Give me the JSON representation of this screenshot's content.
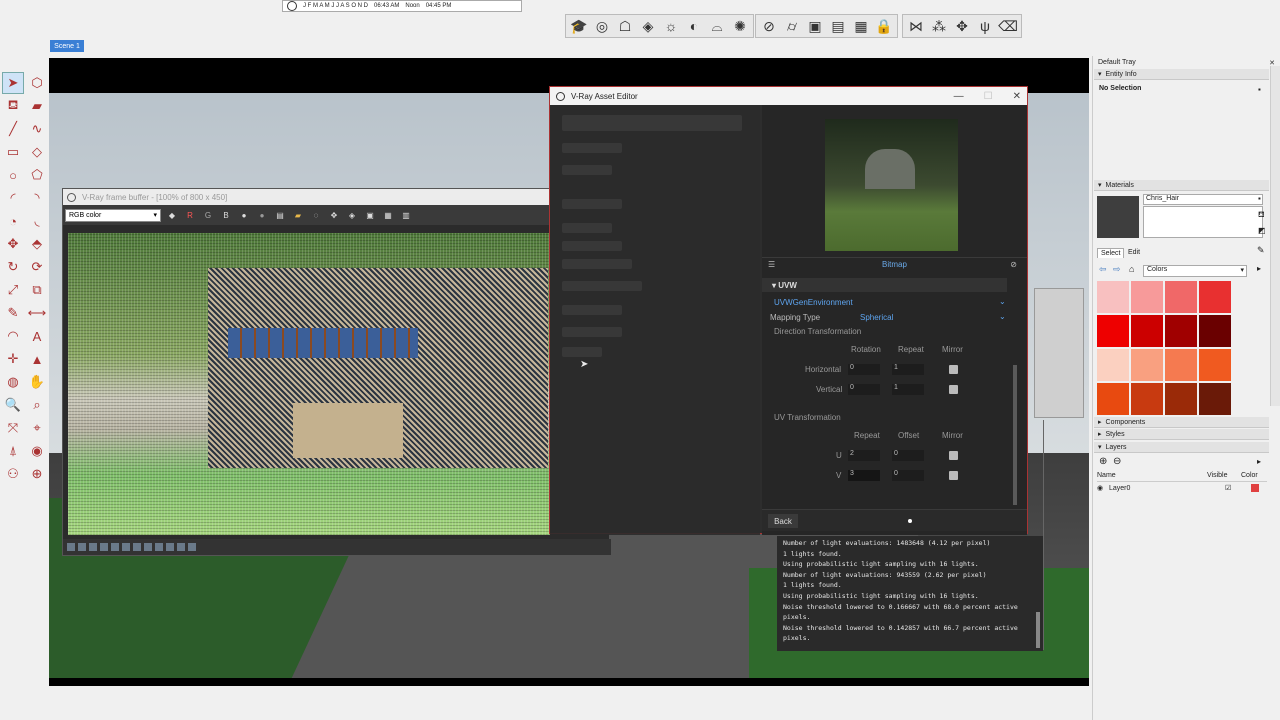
{
  "shadow_bar": {
    "months": "J F M A M J J A S O N D",
    "time_start": "06:43 AM",
    "time_mid": "Noon",
    "time_end": "04:45 PM"
  },
  "scene_tab": "Scene 1",
  "frame_buffer": {
    "title": "V-Ray frame buffer - [100% of 800 x 450]",
    "channel": "RGB color",
    "btn_r": "R",
    "btn_g": "G",
    "btn_b": "B"
  },
  "asset_editor": {
    "title": "V-Ray Asset Editor",
    "bitmap_label": "Bitmap",
    "uvw_header": "UVW",
    "uvw_type": "UVWGenEnvironment",
    "mapping_type_label": "Mapping Type",
    "mapping_type_value": "Spherical",
    "direction_label": "Direction Transformation",
    "dir_cols": [
      "Rotation",
      "Repeat",
      "Mirror"
    ],
    "horizontal_label": "Horizontal",
    "horizontal_rotation": "0",
    "horizontal_repeat": "1",
    "vertical_label": "Vertical",
    "vertical_rotation": "0",
    "vertical_repeat": "1",
    "uv_label": "UV Transformation",
    "uv_cols": [
      "Repeat",
      "Offset",
      "Mirror"
    ],
    "u_label": "U",
    "u_repeat": "2",
    "u_offset": "0",
    "v_label": "V",
    "v_repeat": "3",
    "v_offset": "0",
    "back_label": "Back"
  },
  "log_lines": [
    "Number of light evaluations: 1483648 (4.12 per pixel)",
    "1 lights found.",
    "Using probabilistic light sampling with 16 lights.",
    "Number of light evaluations: 943559 (2.62 per pixel)",
    "1 lights found.",
    "Using probabilistic light sampling with 16 lights.",
    "Noise threshold lowered to 0.166667 with 68.0 percent active",
    "pixels.",
    "Noise threshold lowered to 0.142857 with 66.7 percent active",
    "pixels."
  ],
  "tray": {
    "title": "Default Tray",
    "entity_info": "Entity Info",
    "no_selection": "No Selection",
    "materials": "Materials",
    "material_name": "Chris_Hair",
    "tab_select": "Select",
    "tab_edit": "Edit",
    "library": "Colors",
    "components": "Components",
    "styles": "Styles",
    "layers": "Layers",
    "col_name": "Name",
    "col_visible": "Visible",
    "col_color": "Color",
    "layer_name": "Layer0"
  },
  "palette_colors": [
    "#f8c0c0",
    "#f79a9a",
    "#f06868",
    "#e83030",
    "#ee0000",
    "#cc0000",
    "#a00000",
    "#6a0000",
    "#fbd0c0",
    "#f9a080",
    "#f57a50",
    "#f05a20",
    "#e84a10",
    "#c83a10",
    "#9a2a08",
    "#6a1a08"
  ],
  "colors": {
    "accent": "#3a7fd5",
    "vray_blue": "#5ea5f0",
    "layer_color": "#e04040"
  }
}
